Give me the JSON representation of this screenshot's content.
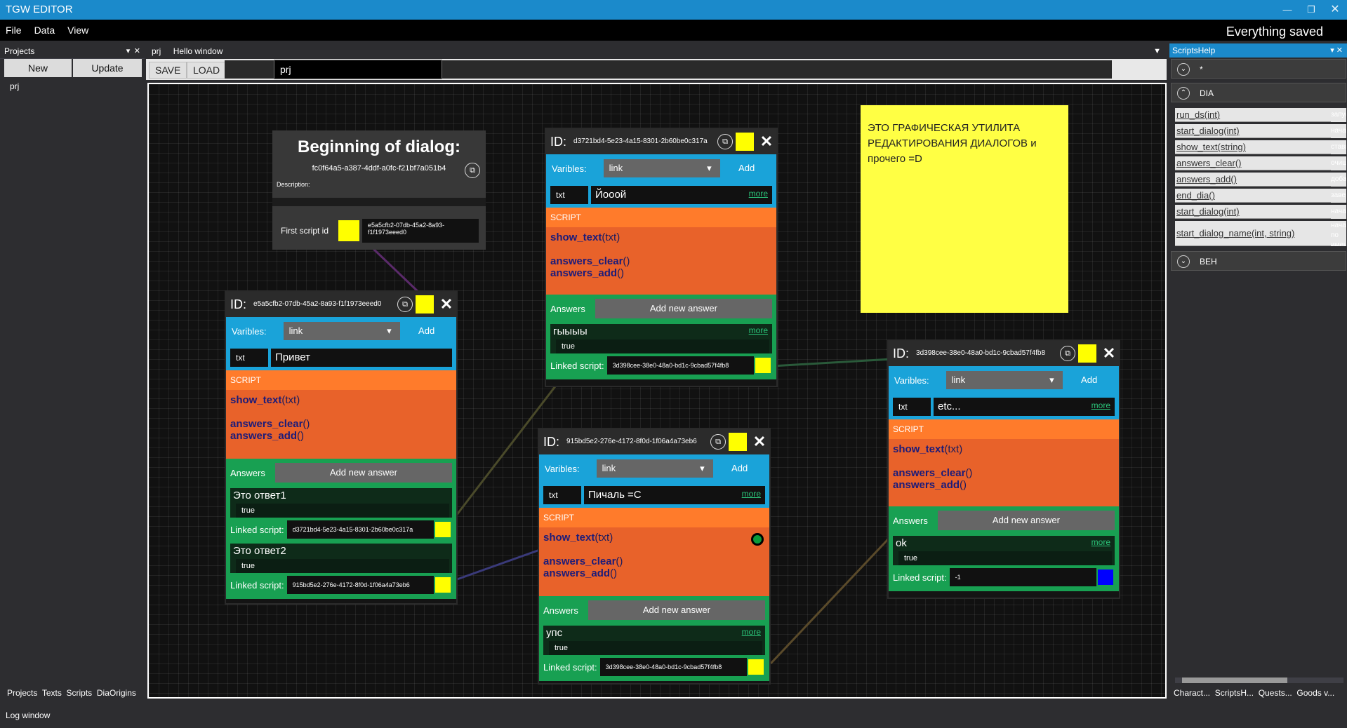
{
  "app": {
    "title": "TGW EDITOR",
    "status": "Everything saved"
  },
  "menu": [
    "File",
    "Data",
    "View"
  ],
  "projects": {
    "title": "Projects",
    "new_label": "New",
    "update_label": "Update",
    "items": [
      "prj"
    ],
    "tabs": [
      "Projects",
      "Texts",
      "Scripts",
      "DiaOrigins"
    ]
  },
  "doc": {
    "tabs": [
      "prj",
      "Hello window"
    ],
    "save_label": "SAVE",
    "load_label": "LOAD",
    "project_value": "prj"
  },
  "beginning": {
    "title": "Beginning of dialog:",
    "id": "fc0f64a5-a387-4ddf-a0fc-f21bf7a051b4",
    "desc_label": "Description:",
    "first_label": "First script id",
    "first_id": "e5a5cfb2-07db-45a2-8a93-f1f1973eeed0"
  },
  "labels": {
    "id": "ID:",
    "vars": "Varibles:",
    "link": "link",
    "add": "Add",
    "txt": "txt",
    "script": "SCRIPT",
    "answers": "Answers",
    "add_answer": "Add new answer",
    "linked": "Linked script:",
    "more": "more",
    "show_text": "show_text",
    "show_arg": "(txt)",
    "clear": "answers_clear",
    "add_fn": "answers_add",
    "parens": "()",
    "true": "true"
  },
  "nodes": [
    {
      "id": "e5a5cfb2-07db-45a2-8a93-f1f1973eeed0",
      "txt": "Привет",
      "answers": [
        {
          "text": "Это ответ1",
          "linked": "d3721bd4-5e23-4a15-8301-2b60be0c317a",
          "color": "#ffff00"
        },
        {
          "text": "Это ответ2",
          "linked": "915bd5e2-276e-4172-8f0d-1f06a4a73eb6",
          "color": "#ffff00"
        }
      ]
    },
    {
      "id": "d3721bd4-5e23-4a15-8301-2b60be0c317a",
      "txt": "Йооой",
      "answers": [
        {
          "text": "гыыыы",
          "linked": "3d398cee-38e0-48a0-bd1c-9cbad57f4fb8",
          "color": "#ffff00"
        }
      ]
    },
    {
      "id": "915bd5e2-276e-4172-8f0d-1f06a4a73eb6",
      "txt": "Пичаль =С",
      "answers": [
        {
          "text": "упс",
          "linked": "3d398cee-38e0-48a0-bd1c-9cbad57f4fb8",
          "color": "#ffff00"
        }
      ]
    },
    {
      "id": "3d398cee-38e0-48a0-bd1c-9cbad57f4fb8",
      "txt": "etc...",
      "answers": [
        {
          "text": "ok",
          "linked": "-1",
          "color": "#0000ff"
        }
      ]
    }
  ],
  "sticky": "ЭТО ГРАФИЧЕСКАЯ УТИЛИТА РЕДАКТИРОВАНИЯ ДИАЛОГОВ и прочего =D",
  "help": {
    "title": "ScriptsHelp",
    "star": "*",
    "group1": "DIA",
    "group2": "BEH",
    "items": [
      {
        "fn": "run_ds(int)",
        "hint": "запуск"
      },
      {
        "fn": "start_dialog(int)",
        "hint": "начать"
      },
      {
        "fn": "show_text(string)",
        "hint": "ставит"
      },
      {
        "fn": "answers_clear()",
        "hint": "очищает"
      },
      {
        "fn": "answers_add()",
        "hint": "добавляет"
      },
      {
        "fn": "end_dia()",
        "hint": "завершает"
      },
      {
        "fn": "start_dialog(int)",
        "hint": "начать"
      },
      {
        "fn": "start_dialog_name(int, string)",
        "hint": "начать по имени"
      }
    ],
    "tabs": [
      "Charact...",
      "ScriptsH...",
      "Quests...",
      "Goods v..."
    ]
  },
  "log": "Log window"
}
